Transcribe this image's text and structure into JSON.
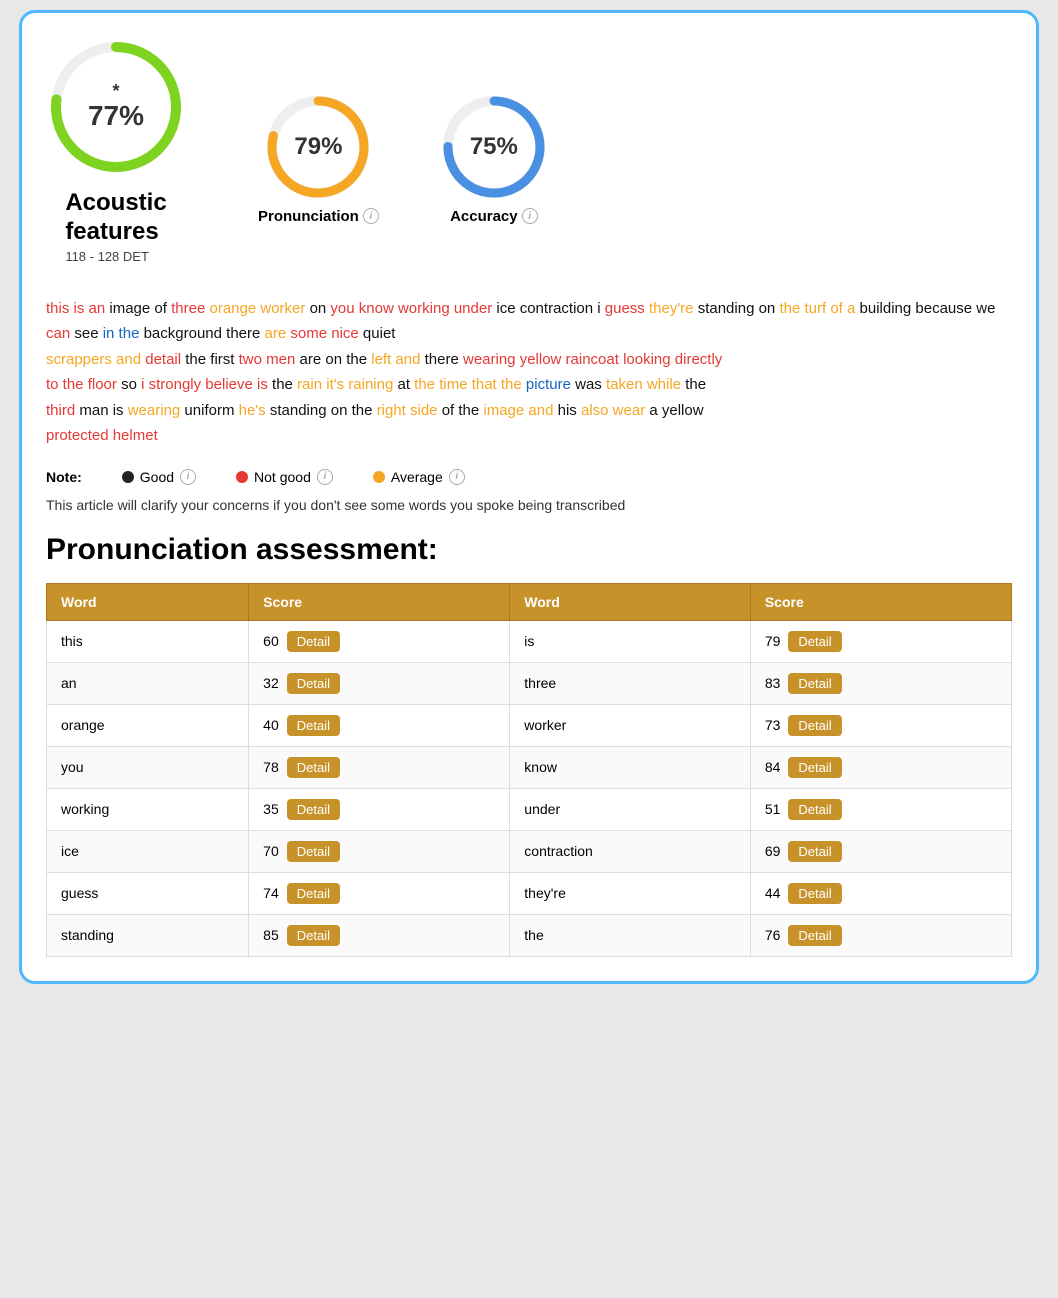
{
  "card": {
    "border_color": "#4db8ff"
  },
  "scores": {
    "overall": {
      "value": "77%",
      "star": "*",
      "color": "#7ED321"
    },
    "pronunciation": {
      "value": "79%",
      "label": "Pronunciation",
      "color": "#F5A623"
    },
    "accuracy": {
      "value": "75%",
      "label": "Accuracy",
      "color": "#4A90E2"
    }
  },
  "acoustic": {
    "title_line1": "Acoustic",
    "title_line2": "features",
    "subtitle": "118 - 128 DET"
  },
  "transcript": {
    "full_text": "this is an image of three orange worker on you know working under ice contraction i guess they're standing on the turf of a building because we can see in the background there are some nice quiet scrappers and detail the first two men are on the left and there wearing yellow raincoat looking directly to the floor so i strongly believe is the rain it's raining at the time that the picture was taken while the third man is wearing uniform he's standing on the right side of the image and his also wear a yellow protected helmet"
  },
  "note": {
    "label": "Note:",
    "good_label": "Good",
    "not_good_label": "Not good",
    "average_label": "Average"
  },
  "clarify": {
    "text": "This article will clarify your concerns if you don't see some words you spoke being transcribed"
  },
  "assessment": {
    "title": "Pronunciation assessment:"
  },
  "table": {
    "headers": [
      "Word",
      "Score",
      "Word",
      "Score"
    ],
    "rows": [
      {
        "word1": "this",
        "score1": 60,
        "word2": "is",
        "score2": 79
      },
      {
        "word1": "an",
        "score1": 32,
        "word2": "three",
        "score2": 83
      },
      {
        "word1": "orange",
        "score1": 40,
        "word2": "worker",
        "score2": 73
      },
      {
        "word1": "you",
        "score1": 78,
        "word2": "know",
        "score2": 84
      },
      {
        "word1": "working",
        "score1": 35,
        "word2": "under",
        "score2": 51
      },
      {
        "word1": "ice",
        "score1": 70,
        "word2": "contraction",
        "score2": 69
      },
      {
        "word1": "guess",
        "score1": 74,
        "word2": "they're",
        "score2": 44
      },
      {
        "word1": "standing",
        "score1": 85,
        "word2": "the",
        "score2": 76
      }
    ],
    "detail_label": "Detail"
  }
}
